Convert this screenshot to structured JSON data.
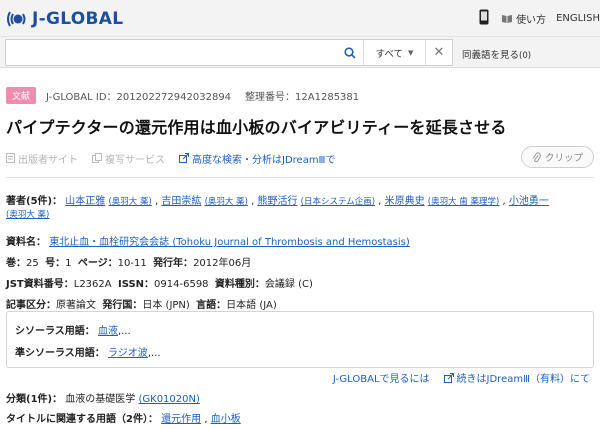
{
  "header": {
    "logo_text": "J-GLOBAL",
    "howto_label": "使い方",
    "language_label": "ENGLISH"
  },
  "search": {
    "placeholder": "",
    "scope_label": "すべて",
    "synonym_label": "同義語を見る",
    "synonym_count": "(0)"
  },
  "record": {
    "type_badge": "文献",
    "jglobal_id": "J-GLOBAL ID：201202272942032894",
    "reference_no": "整理番号：12A1285381",
    "title": "パイプテクターの還元作用は血小板のバイアビリティーを延長させる"
  },
  "actions": {
    "publisher_site": "出版者サイト",
    "copy_service": "複写サービス",
    "jdream_link": "高度な検索・分析はJDreamⅢで",
    "clip_label": "クリップ"
  },
  "authors": {
    "label": "著者(5件)：",
    "list": [
      {
        "name": "山本正雅",
        "affiliation": "(奥羽大 薬)"
      },
      {
        "name": "吉田崇紘",
        "affiliation": "(奥羽大 薬)"
      },
      {
        "name": "熊野活行",
        "affiliation": "(日本システム企画)"
      },
      {
        "name": "米原典史",
        "affiliation": "(奥羽大 歯 薬理学)"
      },
      {
        "name": "小池勇一",
        "affiliation": "(奥羽大 薬)"
      }
    ]
  },
  "source": {
    "label": "資料名：",
    "journal": "東北止血・血栓研究会会誌",
    "journal_en": "(Tohoku Journal of Thrombosis and Hemostasis)"
  },
  "volume": {
    "vol_label": "巻：",
    "vol": "25",
    "issue_label": "号：",
    "issue": "1",
    "page_label": "ページ：",
    "pages": "10-11",
    "year_label": "発行年：",
    "year": "2012年06月"
  },
  "ids": {
    "jst_label": "JST資料番号：",
    "jst": "L2362A",
    "issn_label": "ISSN：",
    "issn": "0914-6598",
    "kind_label": "資料種別：",
    "kind": "会議録 (C)"
  },
  "classification": {
    "article_label": "記事区分：",
    "article": "原著論文",
    "country_label": "発行国：",
    "country": "日本 (JPN)",
    "lang_label": "言語：",
    "lang": "日本語 (JA)"
  },
  "thesaurus": {
    "terms_label": "シソーラス用語：",
    "term": "血液",
    "quasi_label": "準シソーラス用語：",
    "quasi_term": "ラジオ波",
    "ellipsis": ",..."
  },
  "more": {
    "jglobal_label": "J-GLOBALで見るには",
    "continue_label": "続きはJDreamⅢ（有料）にて"
  },
  "category": {
    "label": "分類(1件)：",
    "name": "血液の基礎医学",
    "code": "(GK01020N)"
  },
  "related": {
    "label": "タイトルに関連する用語（2件）：",
    "terms": [
      "還元作用",
      "血小板"
    ]
  },
  "colors": {
    "brand_blue": "#1f4f9c",
    "link_blue": "#1f5fbf",
    "badge_pink": "#f08cae"
  }
}
